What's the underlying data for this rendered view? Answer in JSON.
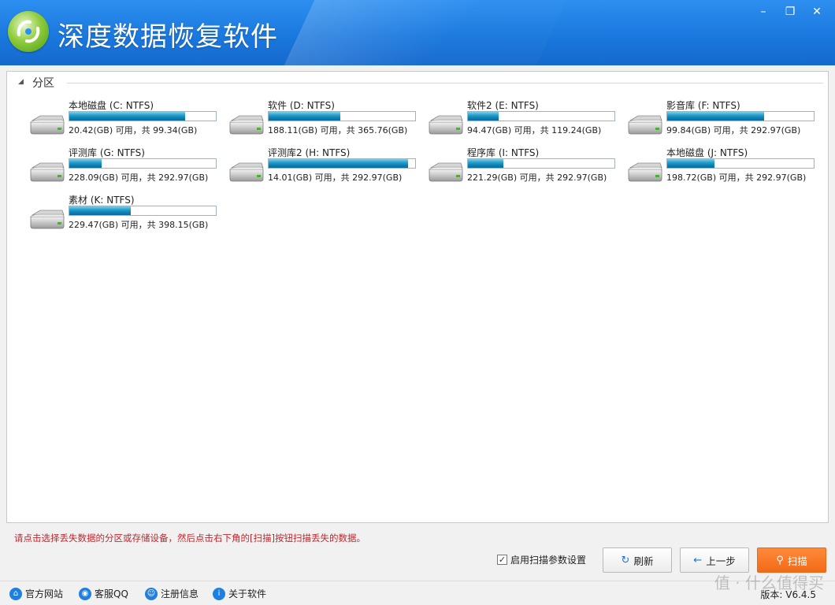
{
  "app": {
    "title": "深度数据恢复软件",
    "window_buttons": {
      "minimize": "–",
      "restore": "❐",
      "close": "✕"
    }
  },
  "group": {
    "label": "分区",
    "arrow": "◢"
  },
  "drives": [
    {
      "name": "本地磁盘 (C: NTFS)",
      "info": "20.42(GB) 可用，共 99.34(GB)",
      "used_fraction": 0.79
    },
    {
      "name": "软件 (D: NTFS)",
      "info": "188.11(GB) 可用，共 365.76(GB)",
      "used_fraction": 0.49
    },
    {
      "name": "软件2 (E: NTFS)",
      "info": "94.47(GB) 可用，共 119.24(GB)",
      "used_fraction": 0.21
    },
    {
      "name": "影音库 (F: NTFS)",
      "info": "99.84(GB) 可用，共 292.97(GB)",
      "used_fraction": 0.66
    },
    {
      "name": "评测库 (G: NTFS)",
      "info": "228.09(GB) 可用，共 292.97(GB)",
      "used_fraction": 0.22
    },
    {
      "name": "评测库2 (H: NTFS)",
      "info": "14.01(GB) 可用，共 292.97(GB)",
      "used_fraction": 0.95
    },
    {
      "name": "程序库 (I: NTFS)",
      "info": "221.29(GB) 可用，共 292.97(GB)",
      "used_fraction": 0.24
    },
    {
      "name": "本地磁盘 (J: NTFS)",
      "info": "198.72(GB) 可用，共 292.97(GB)",
      "used_fraction": 0.32
    },
    {
      "name": "素材 (K: NTFS)",
      "info": "229.47(GB) 可用，共 398.15(GB)",
      "used_fraction": 0.42
    }
  ],
  "hint": "请点击选择丢失数据的分区或存储设备，然后点击右下角的[扫描]按钮扫描丢失的数据。",
  "scan_settings": {
    "label": "启用扫描参数设置",
    "checked": true,
    "check_glyph": "✓"
  },
  "buttons": {
    "refresh": {
      "label": "刷新",
      "icon": "↻"
    },
    "back": {
      "label": "上一步",
      "icon": "←"
    },
    "scan": {
      "label": "扫描",
      "icon": "⚲"
    }
  },
  "footer": {
    "links": [
      {
        "label": "官方网站",
        "icon": "⌂"
      },
      {
        "label": "客服QQ",
        "icon": "◉"
      },
      {
        "label": "注册信息",
        "icon": "☺"
      },
      {
        "label": "关于软件",
        "icon": "i"
      }
    ],
    "version": "版本: V6.4.5"
  },
  "watermark": "值 · 什么值得买",
  "colors": {
    "titlebar": "#1a78de",
    "hint": "#c1272d",
    "scan_button": "#f26a17",
    "progress": "#1a8fc4"
  }
}
